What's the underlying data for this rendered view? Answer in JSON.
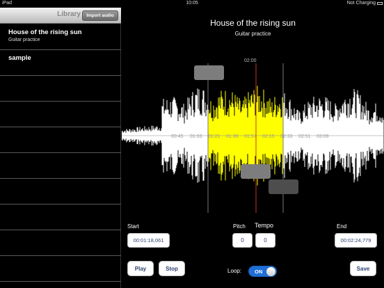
{
  "status_bar": {
    "device": "iPad",
    "time": "10:05",
    "charging": "Not Charging"
  },
  "sidebar": {
    "title": "Library",
    "import_button": "Import audio",
    "items": [
      {
        "title": "House of the rising sun",
        "subtitle": "Guitar practice"
      },
      {
        "title": "sample",
        "subtitle": ""
      }
    ]
  },
  "main": {
    "title": "House of the rising sun",
    "subtitle": "Guitar practice",
    "playhead_time": "02:00",
    "tick_labels": [
      "00:45",
      "01:03",
      "01:21",
      "01:39",
      "01:57",
      "02:15",
      "02:33",
      "02:51",
      "03:09"
    ],
    "colors": {
      "selection": "#ffff00",
      "waveform": "#ffffff",
      "playhead": "#cc3322",
      "accent": "#1f6fd6",
      "button_text": "#2b3f73"
    }
  },
  "controls": {
    "start_label": "Start",
    "start_value": "00:01:18,061",
    "pitch_label": "Pitch",
    "pitch_value": "0",
    "tempo_label": "Tempo",
    "tempo_value": "0",
    "end_label": "End",
    "end_value": "00:02:24,779",
    "play_button": "Play",
    "stop_button": "Stop",
    "loop_label": "Loop:",
    "loop_state": "ON",
    "save_button": "Save"
  }
}
